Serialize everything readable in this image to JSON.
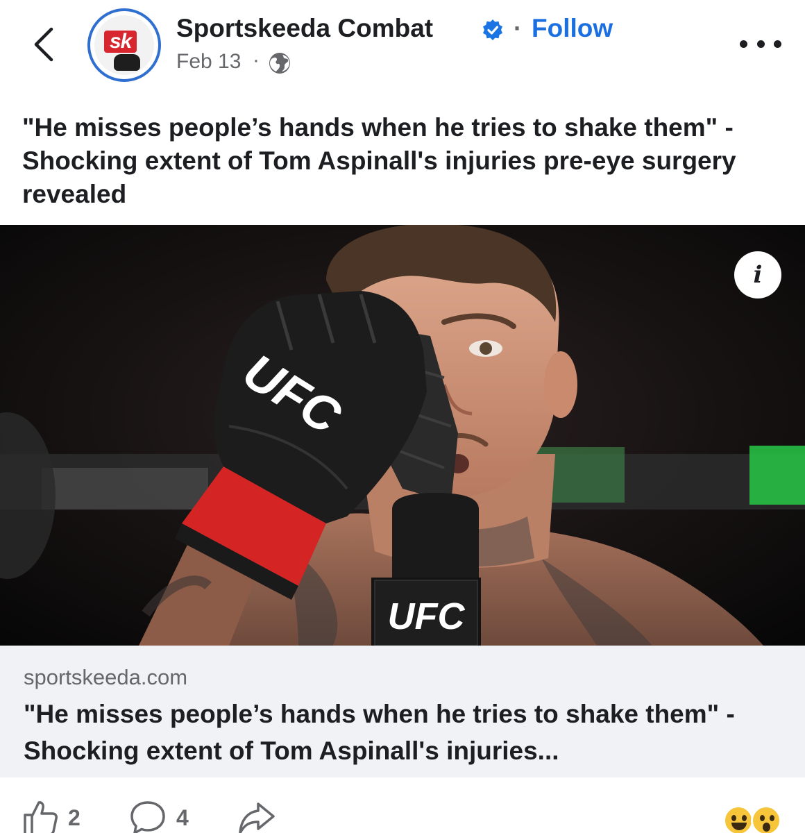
{
  "post": {
    "page_name": "Sportskeeda Combat",
    "separator": "·",
    "follow_label": "Follow",
    "date": "Feb 13",
    "meta_separator": "·",
    "avatar_text": "sk",
    "caption": "\"He misses people’s hands when he tries to shake them\" - Shocking extent of Tom Aspinall's injuries pre-eye surgery revealed"
  },
  "photo": {
    "glove_logo": "UFC",
    "mic_logo": "UFC",
    "info_label": "i"
  },
  "link": {
    "domain": "sportskeeda.com",
    "title": "\"He misses people’s hands when he tries to shake them\" - Shocking extent of Tom Aspinall's injuries..."
  },
  "actions": {
    "like_count": "2",
    "comment_count": "4"
  },
  "icons": {
    "back": "chevron-left-icon",
    "verified": "verified-badge-icon",
    "audience": "globe-icon",
    "more": "more-dots-icon",
    "like": "thumbs-up-icon",
    "comment": "comment-bubble-icon",
    "share": "share-arrow-icon"
  },
  "colors": {
    "link_blue": "#1b6fe0",
    "text_primary": "#1c1e21",
    "text_secondary": "#65676b",
    "card_background": "#f0f2f5",
    "brand_red": "#d8262f"
  }
}
